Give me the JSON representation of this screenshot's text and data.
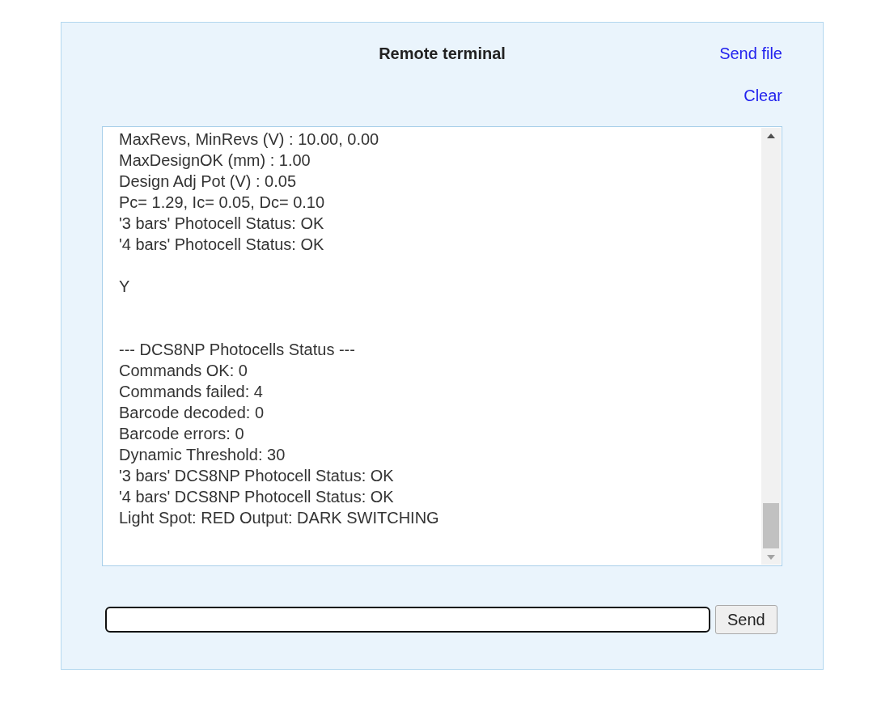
{
  "panel": {
    "title": "Remote terminal",
    "links": [
      "Send file",
      "Clear"
    ]
  },
  "terminal": {
    "output": "MaxRevs, MinRevs (V) : 10.00, 0.00\nMaxDesignOK (mm) : 1.00\nDesign Adj Pot (V) : 0.05\nPc= 1.29, Ic= 0.05, Dc= 0.10\n'3 bars' Photocell Status: OK\n'4 bars' Photocell Status: OK\n\nY\n\n\n--- DCS8NP Photocells Status ---\nCommands OK: 0\nCommands failed: 4\nBarcode decoded: 0\nBarcode errors: 0\nDynamic Threshold: 30\n'3 bars' DCS8NP Photocell Status: OK\n'4 bars' DCS8NP Photocell Status: OK\nLight Spot: RED Output: DARK SWITCHING"
  },
  "command": {
    "send_button": "Send"
  }
}
